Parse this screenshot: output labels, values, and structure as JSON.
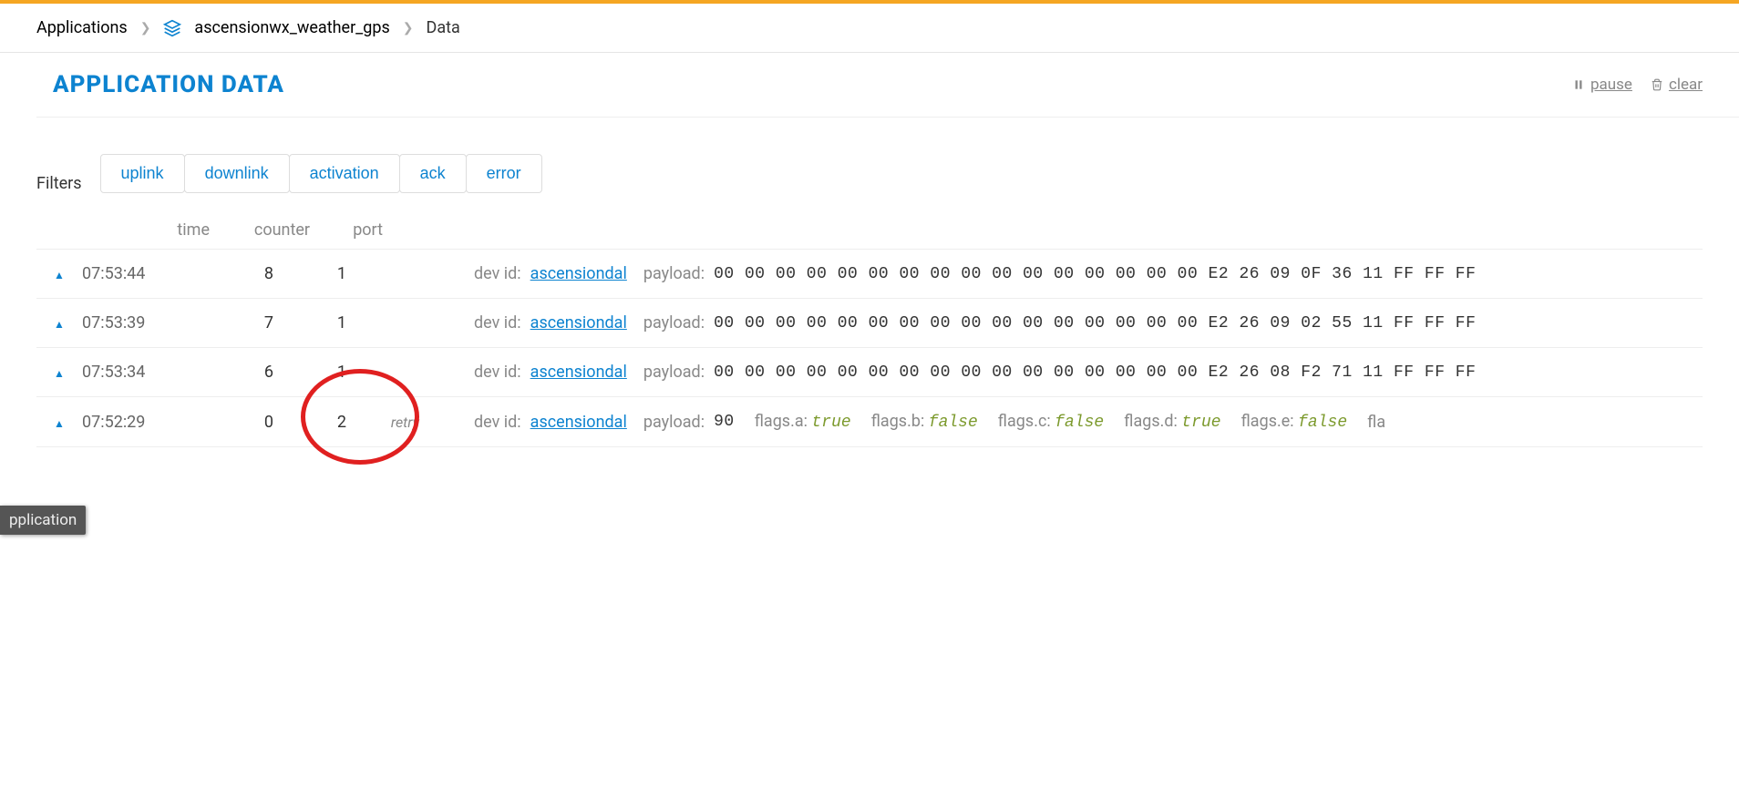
{
  "breadcrumb": {
    "applications": "Applications",
    "app_name": "ascensionwx_weather_gps",
    "current": "Data"
  },
  "page": {
    "title": "APPLICATION DATA",
    "pause_label": "pause",
    "clear_label": "clear"
  },
  "filters": {
    "label": "Filters",
    "buttons": [
      "uplink",
      "downlink",
      "activation",
      "ack",
      "error"
    ]
  },
  "table": {
    "headers": {
      "time": "time",
      "counter": "counter",
      "port": "port"
    },
    "labels": {
      "devid": "dev id:",
      "payload": "payload:",
      "retry": "retry"
    },
    "rows": [
      {
        "time": "07:53:44",
        "counter": "8",
        "port": "1",
        "retry": "",
        "dev_id": "ascensiondal",
        "payload": "00 00 00 00 00 00 00 00 00 00 00 00 00 00 00 00 E2 26 09 0F 36 11 FF FF FF",
        "flags": null
      },
      {
        "time": "07:53:39",
        "counter": "7",
        "port": "1",
        "retry": "",
        "dev_id": "ascensiondal",
        "payload": "00 00 00 00 00 00 00 00 00 00 00 00 00 00 00 00 E2 26 09 02 55 11 FF FF FF",
        "flags": null
      },
      {
        "time": "07:53:34",
        "counter": "6",
        "port": "1",
        "retry": "",
        "dev_id": "ascensiondal",
        "payload": "00 00 00 00 00 00 00 00 00 00 00 00 00 00 00 00 E2 26 08 F2 71 11 FF FF FF",
        "flags": null
      },
      {
        "time": "07:52:29",
        "counter": "0",
        "port": "2",
        "retry": "retry",
        "dev_id": "ascensiondal",
        "payload": "90",
        "flags": [
          {
            "name": "flags.a",
            "value": "true"
          },
          {
            "name": "flags.b",
            "value": "false"
          },
          {
            "name": "flags.c",
            "value": "false"
          },
          {
            "name": "flags.d",
            "value": "true"
          },
          {
            "name": "flags.e",
            "value": "false"
          }
        ],
        "trail": "fla"
      }
    ]
  },
  "float_tag": "pplication",
  "annotation": {
    "circle_row": 3
  }
}
